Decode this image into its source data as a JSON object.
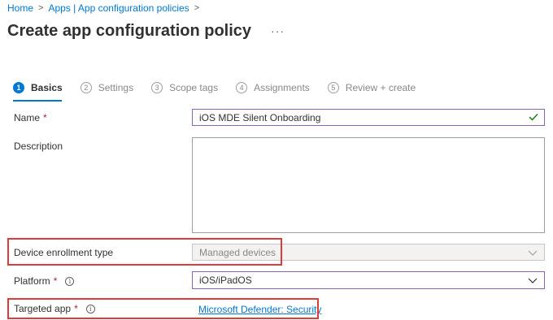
{
  "breadcrumb": {
    "home": "Home",
    "apps": "Apps | App configuration policies",
    "sep": ">"
  },
  "page": {
    "title": "Create app configuration policy",
    "more": "···"
  },
  "steps": [
    {
      "num": "1",
      "label": "Basics",
      "active": true
    },
    {
      "num": "2",
      "label": "Settings",
      "active": false
    },
    {
      "num": "3",
      "label": "Scope tags",
      "active": false
    },
    {
      "num": "4",
      "label": "Assignments",
      "active": false
    },
    {
      "num": "5",
      "label": "Review + create",
      "active": false
    }
  ],
  "form": {
    "name_label": "Name",
    "required_mark": "*",
    "name_value": "iOS MDE Silent Onboarding",
    "description_label": "Description",
    "description_value": "",
    "enrollment_label": "Device enrollment type",
    "enrollment_value": "Managed devices",
    "platform_label": "Platform",
    "platform_value": "iOS/iPadOS",
    "targeted_app_label": "Targeted app",
    "targeted_app_value": "Microsoft Defender: Security",
    "info_glyph": "i"
  },
  "colors": {
    "accent": "#0078d4",
    "highlight": "#e03b3b",
    "valid": "#107c10",
    "focus_border": "#8764b8"
  },
  "icons": {
    "check": "check-icon",
    "chevron": "chevron-down-icon",
    "info": "info-icon"
  }
}
